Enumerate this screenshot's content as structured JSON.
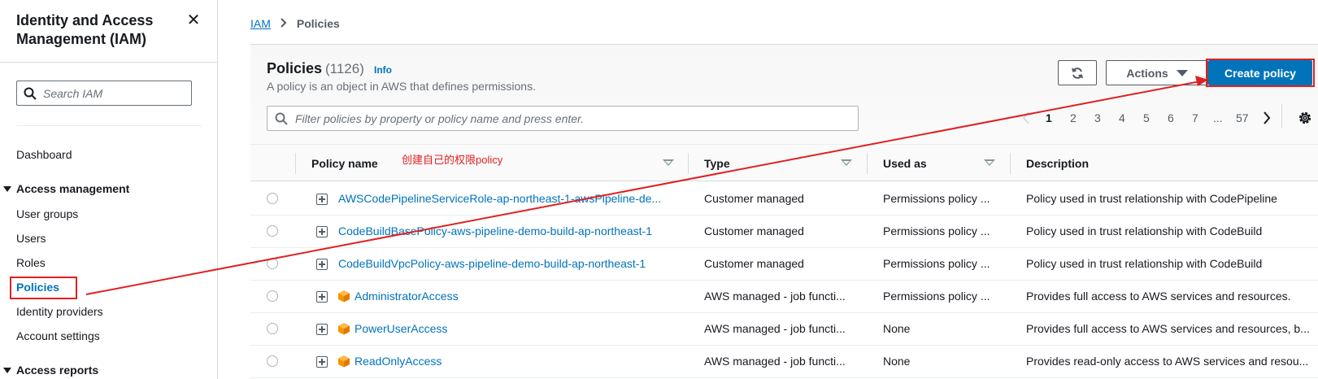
{
  "sidebar": {
    "title": "Identity and Access Management (IAM)",
    "search_placeholder": "Search IAM",
    "dashboard": "Dashboard",
    "access_management": "Access management",
    "items": [
      "User groups",
      "Users",
      "Roles",
      "Policies",
      "Identity providers",
      "Account settings"
    ],
    "access_reports": "Access reports",
    "active_item": "Policies"
  },
  "breadcrumb": {
    "root": "IAM",
    "current": "Policies"
  },
  "panel": {
    "title": "Policies",
    "count": "(1126)",
    "info": "Info",
    "description": "A policy is an object in AWS that defines permissions.",
    "actions_label": "Actions",
    "create_label": "Create policy",
    "filter_placeholder": "Filter policies by property or policy name and press enter."
  },
  "pagination": {
    "pages": [
      "1",
      "2",
      "3",
      "4",
      "5",
      "6",
      "7",
      "...",
      "57"
    ],
    "current": "1"
  },
  "table": {
    "columns": [
      "Policy name",
      "Type",
      "Used as",
      "Description"
    ],
    "annotation": "创建自己的权限policy",
    "rows": [
      {
        "name": "AWSCodePipelineServiceRole-ap-northeast-1-awsPipeline-de...",
        "aws_icon": false,
        "type": "Customer managed",
        "used_as": "Permissions policy ...",
        "description": "Policy used in trust relationship with CodePipeline"
      },
      {
        "name": "CodeBuildBasePolicy-aws-pipeline-demo-build-ap-northeast-1",
        "aws_icon": false,
        "type": "Customer managed",
        "used_as": "Permissions policy ...",
        "description": "Policy used in trust relationship with CodeBuild"
      },
      {
        "name": "CodeBuildVpcPolicy-aws-pipeline-demo-build-ap-northeast-1",
        "aws_icon": false,
        "type": "Customer managed",
        "used_as": "Permissions policy ...",
        "description": "Policy used in trust relationship with CodeBuild"
      },
      {
        "name": "AdministratorAccess",
        "aws_icon": true,
        "type": "AWS managed - job functi...",
        "used_as": "Permissions policy ...",
        "description": "Provides full access to AWS services and resources."
      },
      {
        "name": "PowerUserAccess",
        "aws_icon": true,
        "type": "AWS managed - job functi...",
        "used_as": "None",
        "description": "Provides full access to AWS services and resources, b..."
      },
      {
        "name": "ReadOnlyAccess",
        "aws_icon": true,
        "type": "AWS managed - job functi...",
        "used_as": "None",
        "description": "Provides read-only access to AWS services and resou..."
      }
    ]
  },
  "colors": {
    "link": "#0073bb",
    "primary_button": "#0073bb",
    "annotation": "#e02020"
  },
  "icons": [
    "close-icon",
    "search-icon",
    "refresh-icon",
    "gear-icon",
    "caret-down-icon",
    "chevron-left-icon",
    "chevron-right-icon",
    "expand-icon",
    "aws-managed-icon"
  ]
}
